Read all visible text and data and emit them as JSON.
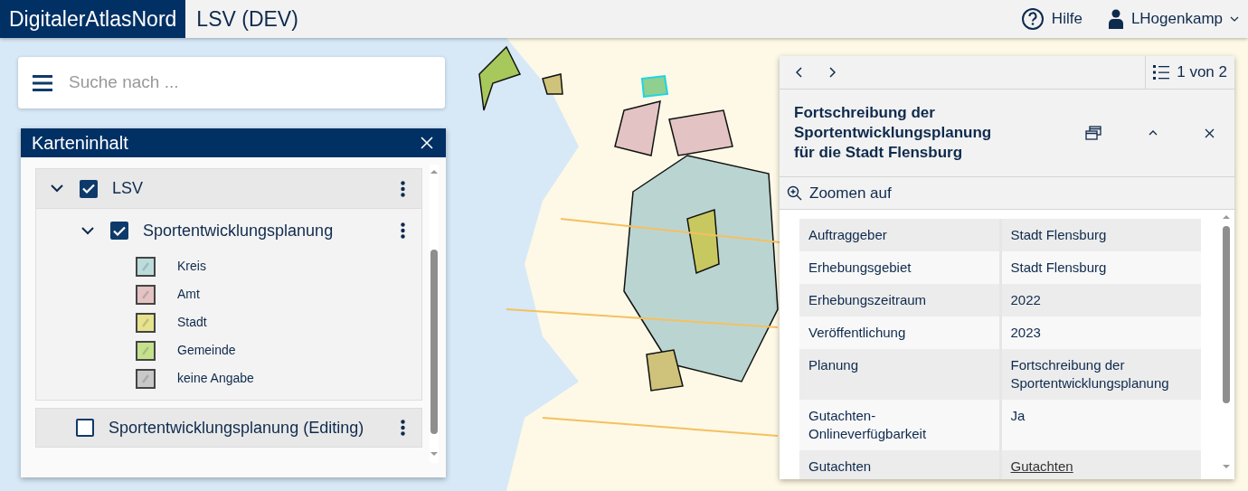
{
  "header": {
    "brand": "DigitalerAtlasNord",
    "app_title": "LSV (DEV)",
    "help": "Hilfe",
    "user": "LHogenkamp"
  },
  "search": {
    "placeholder": "Suche nach ..."
  },
  "layer_panel": {
    "title": "Karteninhalt",
    "layers": [
      {
        "label": "LSV",
        "checked": true,
        "expanded": true,
        "children": [
          {
            "label": "Sportentwicklungsplanung",
            "checked": true,
            "expanded": true,
            "legend": [
              {
                "label": "Kreis",
                "color": "#bcdcdc"
              },
              {
                "label": "Amt",
                "color": "#e3c3c3"
              },
              {
                "label": "Stadt",
                "color": "#e6e38e"
              },
              {
                "label": "Gemeinde",
                "color": "#c4e28e"
              },
              {
                "label": "keine Angabe",
                "color": "#c8c8c8"
              }
            ]
          }
        ]
      },
      {
        "label": "Sportentwicklungsplanung (Editing)",
        "checked": false
      }
    ]
  },
  "feature_panel": {
    "pager": "1 von 2",
    "title": "Fortschreibung der Sportentwicklungsplanung für die Stadt Flensburg",
    "zoom_action": "Zoomen auf",
    "rows": [
      {
        "label": "Auftraggeber",
        "value": "Stadt Flensburg",
        "kind": "text"
      },
      {
        "label": "Erhebungsgebiet",
        "value": "Stadt Flensburg",
        "kind": "text"
      },
      {
        "label": "Erhebungszeitraum",
        "value": "2022",
        "kind": "text"
      },
      {
        "label": "Veröffentlichung",
        "value": "2023",
        "kind": "text"
      },
      {
        "label": "Planung",
        "value": "Fortschreibung der Sportentwicklungsplanung",
        "kind": "text"
      },
      {
        "label": "Gutachten-Onlineverfügbarkeit",
        "value": "Ja",
        "kind": "text"
      },
      {
        "label": "Gutachten",
        "value": "Gutachten",
        "kind": "link"
      }
    ]
  }
}
